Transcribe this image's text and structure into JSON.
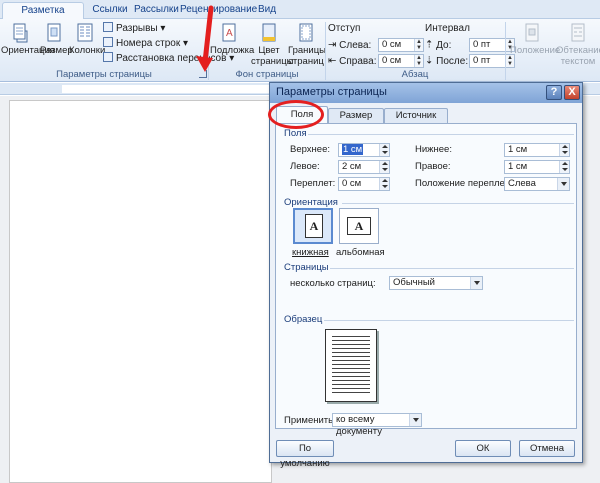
{
  "ribbon": {
    "tabs": [
      "Разметка страницы",
      "Ссылки",
      "Рассылки",
      "Рецензирование",
      "Вид"
    ],
    "page_setup": {
      "orientation": "Ориентация",
      "size": "Размер",
      "columns": "Колонки",
      "breaks": "Разрывы",
      "line_numbers": "Номера строк",
      "hyphenation": "Расстановка переносов",
      "group_title": "Параметры страницы"
    },
    "background": {
      "watermark": "Подложка",
      "page_color": "Цвет страницы",
      "page_borders": "Границы страниц",
      "group_title": "Фон страницы"
    },
    "paragraph": {
      "indent": "Отступ",
      "left_label": "Слева:",
      "left_value": "0 см",
      "right_label": "Справа:",
      "right_value": "0 см",
      "spacing": "Интервал",
      "before_label": "До:",
      "before_value": "0 пт",
      "after_label": "После:",
      "after_value": "0 пт",
      "group_title": "Абзац"
    },
    "arrange": {
      "position": "Положение",
      "wrap": "Обтекание текстом"
    }
  },
  "dialog": {
    "title": "Параметры страницы",
    "help": "?",
    "close": "X",
    "tabs": [
      "Поля",
      "Размер бумаги",
      "Источник бумаги"
    ],
    "margins": {
      "section": "Поля",
      "top_label": "Верхнее:",
      "top_value": "1 см",
      "bottom_label": "Нижнее:",
      "bottom_value": "1 см",
      "left_label": "Левое:",
      "left_value": "2 см",
      "right_label": "Правое:",
      "right_value": "1 см",
      "gutter_label": "Переплет:",
      "gutter_value": "0 см",
      "gutter_pos_label": "Положение переплета:",
      "gutter_pos_value": "Слева"
    },
    "orientation": {
      "section": "Ориентация",
      "portrait": "книжная",
      "landscape": "альбомная"
    },
    "pages": {
      "section": "Страницы",
      "multiple_label": "несколько страниц:",
      "multiple_value": "Обычный"
    },
    "preview": {
      "section": "Образец",
      "apply_label": "Применить:",
      "apply_value": "ко всему документу"
    },
    "buttons": {
      "default": "По умолчанию",
      "ok": "ОК",
      "cancel": "Отмена"
    }
  },
  "colors": {
    "annotation_red": "#e41f1f",
    "ribbon_blue": "#dfe9f5",
    "dialog_bg": "#ecf1f8"
  }
}
